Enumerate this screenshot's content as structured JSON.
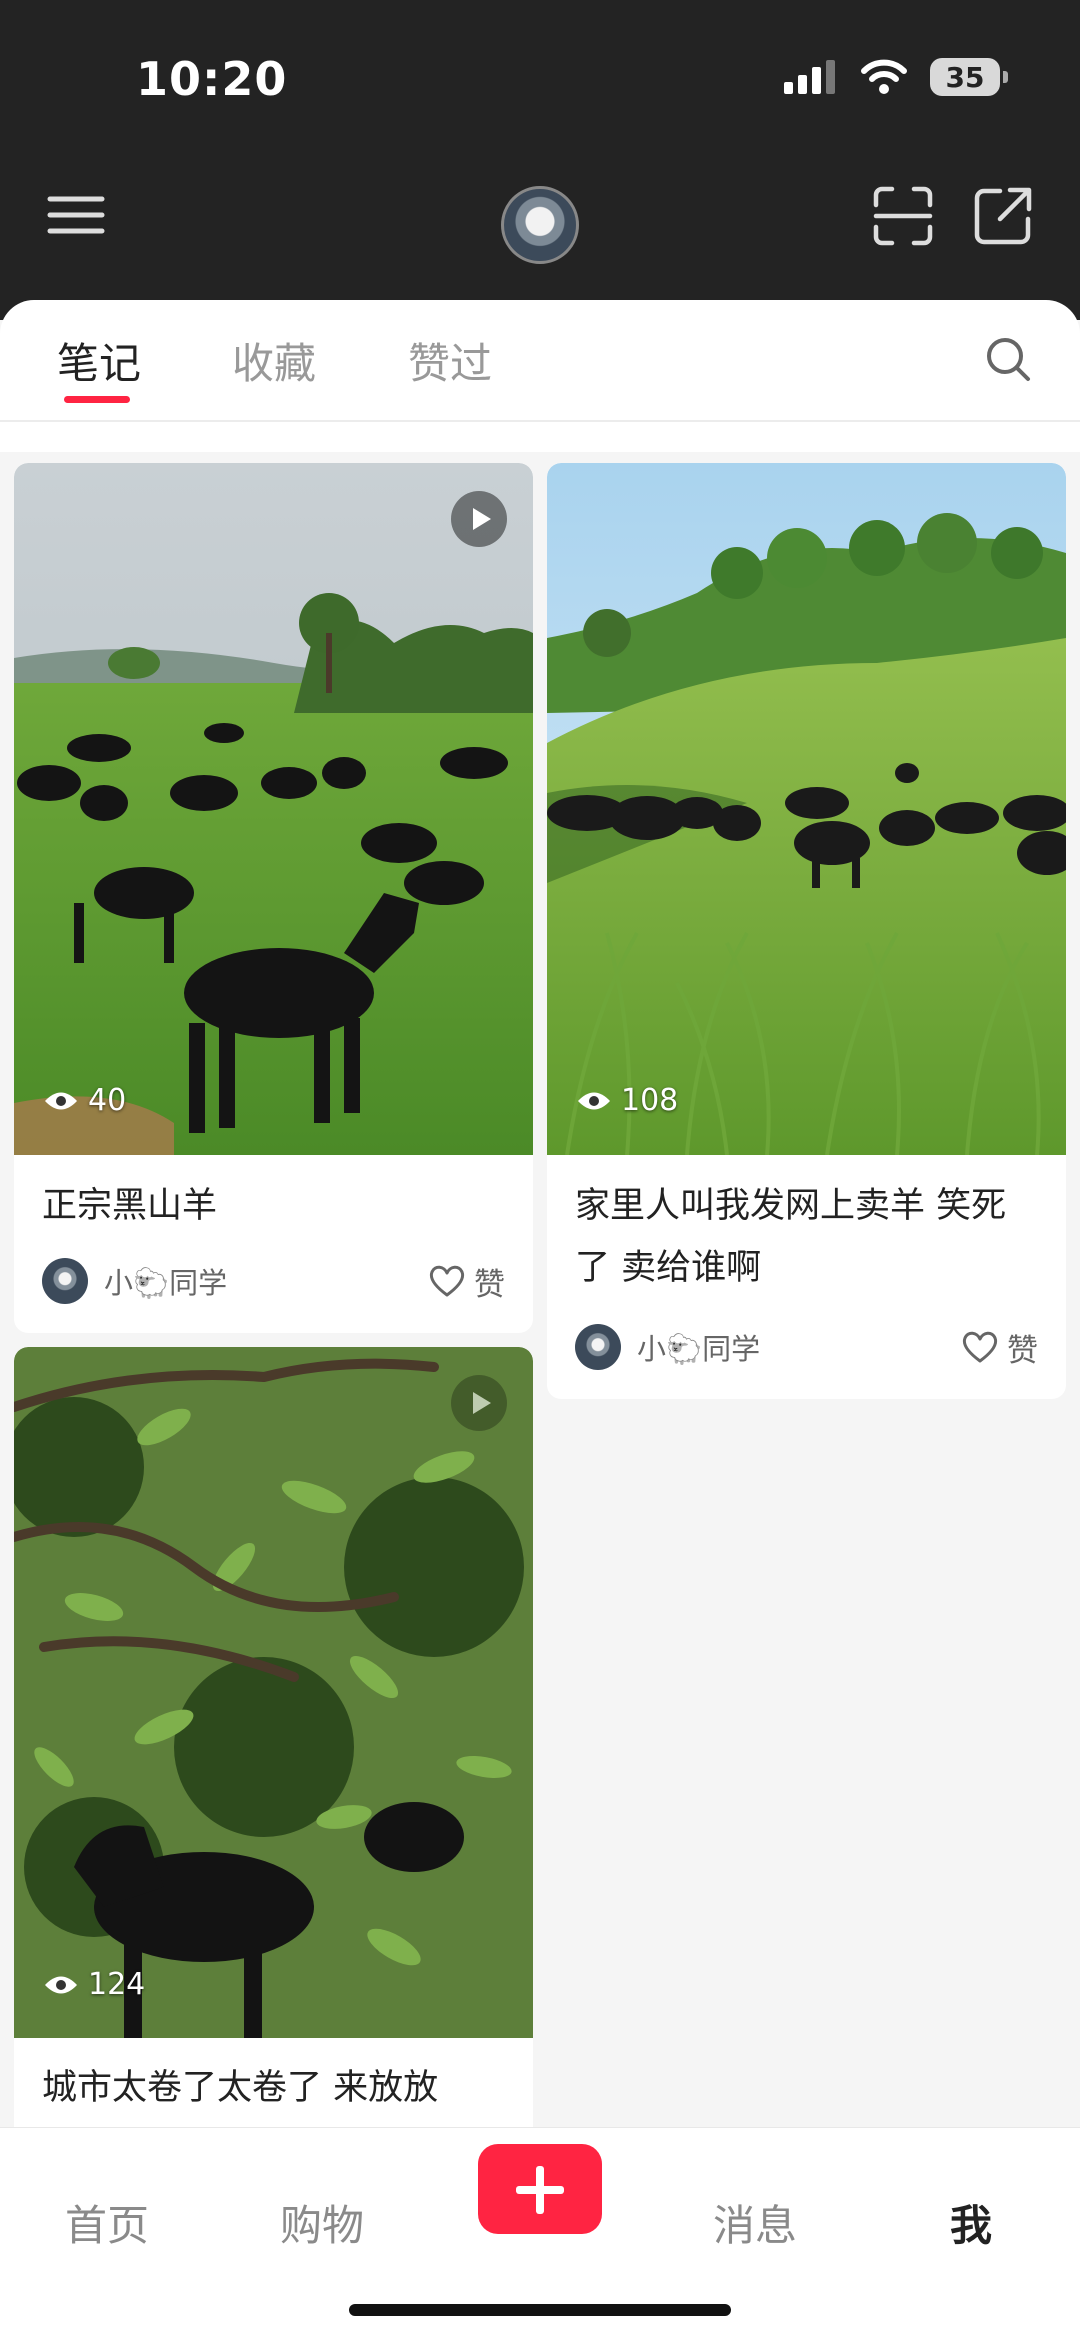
{
  "status_bar": {
    "time": "10:20",
    "battery": "35"
  },
  "tabs": [
    {
      "label": "笔记"
    },
    {
      "label": "收藏"
    },
    {
      "label": "赞过"
    }
  ],
  "notes": [
    {
      "title": "正宗黑山羊",
      "views": "40",
      "author": "小🐑同学",
      "like_label": "赞"
    },
    {
      "title": "家里人叫我发网上卖羊 笑死了 卖给谁啊",
      "views": "108",
      "author": "小🐑同学",
      "like_label": "赞"
    },
    {
      "title": "城市太卷了太卷了 来放放",
      "views": "124"
    }
  ],
  "bottom_nav": {
    "home": "首页",
    "shop": "购物",
    "messages": "消息",
    "me": "我"
  },
  "colors": {
    "accent": "#ff2442",
    "header_bg": "#232323"
  }
}
